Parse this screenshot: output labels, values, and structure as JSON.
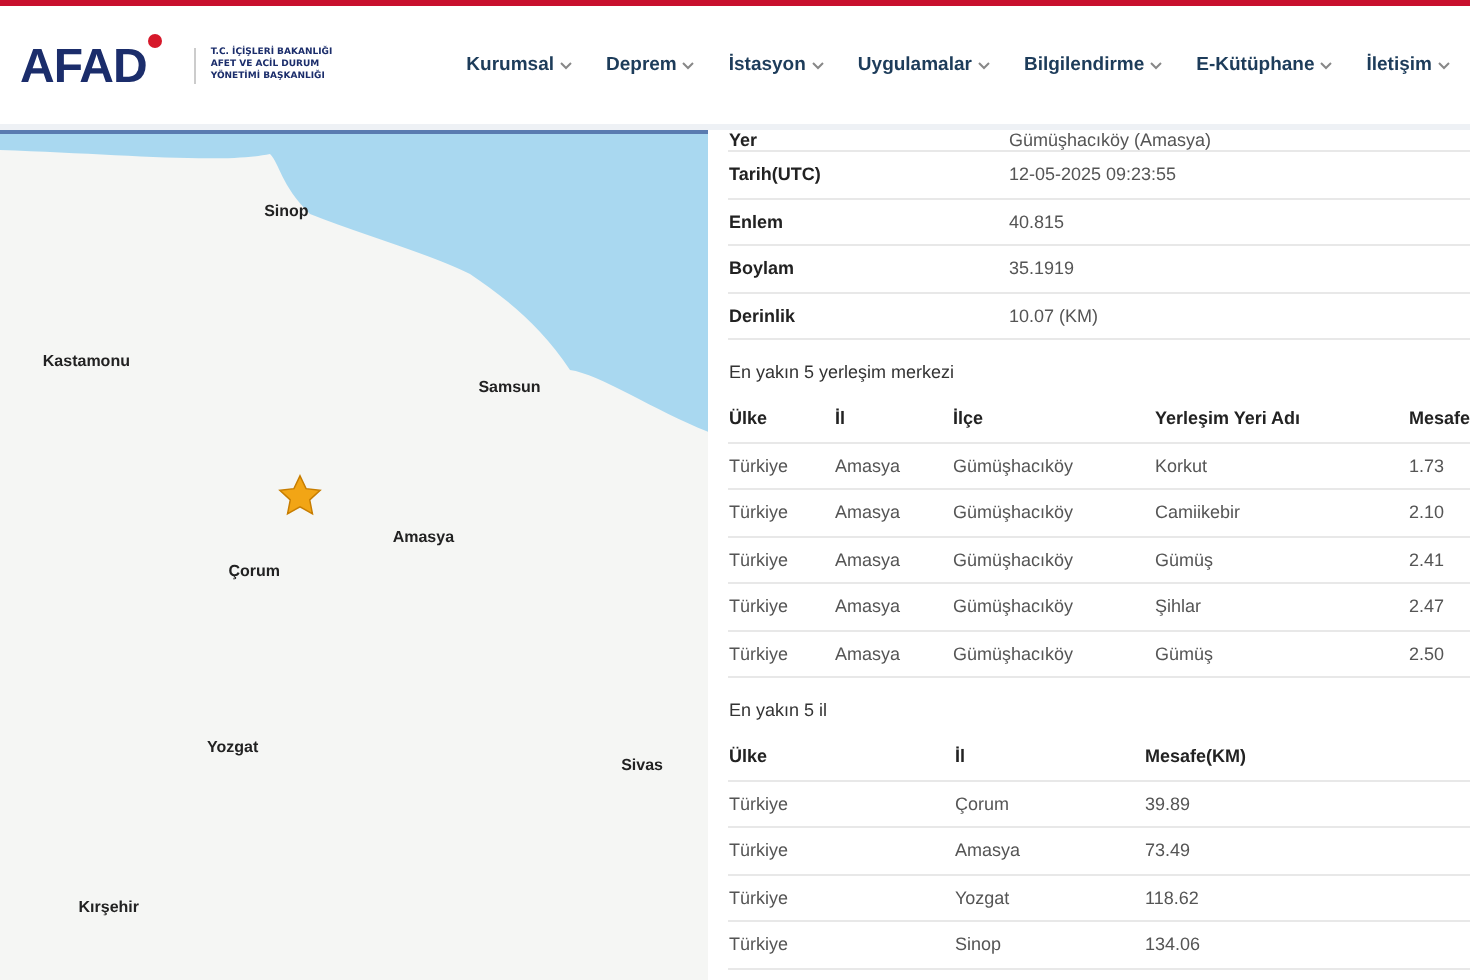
{
  "header": {
    "logo": "AFAD",
    "ministry_lines": [
      "T.C. İÇİŞLERİ BAKANLIĞI",
      "AFET VE ACİL DURUM",
      "YÖNETİMİ BAŞKANLIĞI"
    ],
    "nav": [
      {
        "label": "Kurumsal"
      },
      {
        "label": "Deprem"
      },
      {
        "label": "İstasyon"
      },
      {
        "label": "Uygulamalar"
      },
      {
        "label": "Bilgilendirme"
      },
      {
        "label": "E-Kütüphane"
      },
      {
        "label": "İletişim"
      }
    ]
  },
  "map": {
    "labels": [
      "Sinop",
      "Kastamonu",
      "Samsun",
      "Amasya",
      "Çorum",
      "Yozgat",
      "Sivas",
      "Kırşehir"
    ]
  },
  "details": [
    {
      "label": "Yer",
      "value": "Gümüşhacıköy (Amasya)"
    },
    {
      "label": "Tarih(UTC)",
      "value": "12-05-2025 09:23:55"
    },
    {
      "label": "Enlem",
      "value": "40.815"
    },
    {
      "label": "Boylam",
      "value": "35.1919"
    },
    {
      "label": "Derinlik",
      "value": "10.07 (KM)"
    }
  ],
  "settlements": {
    "title": "En yakın 5 yerleşim merkezi",
    "columns": [
      "Ülke",
      "İl",
      "İlçe",
      "Yerleşim Yeri Adı",
      "Mesafe"
    ],
    "rows": [
      [
        "Türkiye",
        "Amasya",
        "Gümüşhacıköy",
        "Korkut",
        "1.73"
      ],
      [
        "Türkiye",
        "Amasya",
        "Gümüşhacıköy",
        "Camiikebir",
        "2.10"
      ],
      [
        "Türkiye",
        "Amasya",
        "Gümüşhacıköy",
        "Gümüş",
        "2.41"
      ],
      [
        "Türkiye",
        "Amasya",
        "Gümüşhacıköy",
        "Şihlar",
        "2.47"
      ],
      [
        "Türkiye",
        "Amasya",
        "Gümüşhacıköy",
        "Gümüş",
        "2.50"
      ]
    ]
  },
  "provinces": {
    "title": "En yakın 5 il",
    "columns": [
      "Ülke",
      "İl",
      "Mesafe(KM)"
    ],
    "rows": [
      [
        "Türkiye",
        "Çorum",
        "39.89"
      ],
      [
        "Türkiye",
        "Amasya",
        "73.49"
      ],
      [
        "Türkiye",
        "Yozgat",
        "118.62"
      ],
      [
        "Türkiye",
        "Sinop",
        "134.06"
      ]
    ]
  }
}
